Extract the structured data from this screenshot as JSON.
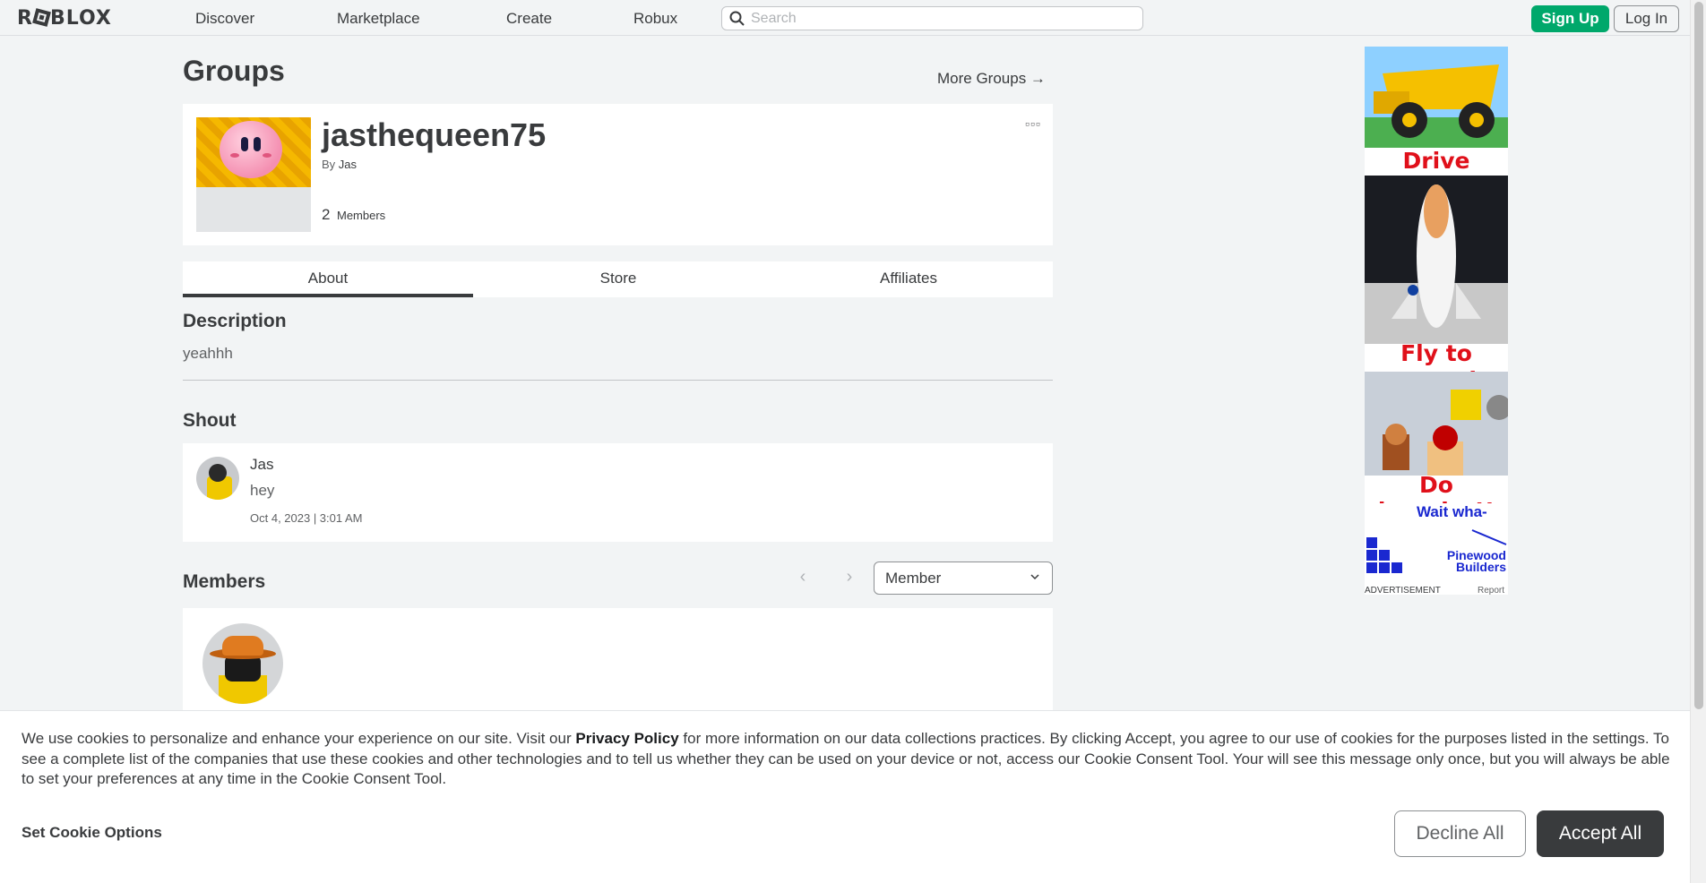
{
  "nav": {
    "logo_text": "ROBLOX",
    "links": [
      "Discover",
      "Marketplace",
      "Create",
      "Robux"
    ],
    "search_placeholder": "Search",
    "signup_label": "Sign Up",
    "login_label": "Log In"
  },
  "page": {
    "title": "Groups",
    "more_groups_label": "More Groups →"
  },
  "group": {
    "name": "jasthequeen75",
    "by_prefix": "By",
    "owner": "Jas",
    "member_count": "2",
    "members_label": "Members",
    "more_icon": "more-dots-icon"
  },
  "tabs": [
    {
      "label": "About",
      "active": true
    },
    {
      "label": "Store",
      "active": false
    },
    {
      "label": "Affiliates",
      "active": false
    }
  ],
  "description": {
    "heading": "Description",
    "text": "yeahhh"
  },
  "shout": {
    "heading": "Shout",
    "user": "Jas",
    "text": "hey",
    "date": "Oct 4, 2023 | 3:01 AM"
  },
  "members": {
    "heading": "Members",
    "role_selected": "Member"
  },
  "ad": {
    "captions": [
      "Drive beasts!",
      "Fly to space!",
      "Do laundry!!"
    ],
    "last_headline": "Wait wha-",
    "brand": "Pinewood Builders",
    "label": "ADVERTISEMENT",
    "report": "Report"
  },
  "cookie": {
    "text_before": "We use cookies to personalize and enhance your experience on our site. Visit our ",
    "privacy_link": "Privacy Policy",
    "text_after": " for more information on our data collections practices. By clicking Accept, you agree to our use of cookies for the purposes listed in the settings. To see a complete list of the companies that use these cookies and other technologies and to tell us whether they can be used on your device or not, access our Cookie Consent Tool. Your will see this message only once, but you will always be able to set your preferences at any time in the Cookie Consent Tool.",
    "options_label": "Set Cookie Options",
    "decline_label": "Decline All",
    "accept_label": "Accept All"
  },
  "colors": {
    "signup_green": "#00a86b",
    "ad_red": "#e0101a",
    "text_dark": "#393b3d"
  }
}
